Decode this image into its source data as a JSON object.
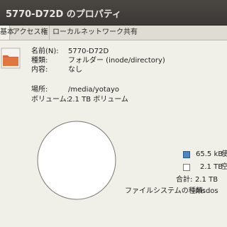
{
  "window": {
    "title": "5770-D72D のプロパティ"
  },
  "tabs": [
    {
      "label": "基本"
    },
    {
      "label": "アクセス権"
    },
    {
      "label": "ローカルネットワーク共有"
    }
  ],
  "basic": {
    "name_label": "名前(N):",
    "name_value": "5770-D72D",
    "type_label": "種類:",
    "type_value": "フォルダー (inode/directory)",
    "contents_label": "内容:",
    "contents_value": "なし",
    "location_label": "場所:",
    "location_value": "/media/yotayo",
    "volume_label": "ボリューム:",
    "volume_value": "2.1 TB ボリューム"
  },
  "usage": {
    "used_value": "65.5 kB",
    "used_label": "使",
    "free_value": "2.1 TB",
    "free_label": "空",
    "total_label": "合計:",
    "total_value": "2.1 TB",
    "filesystem_label": "ファイルシステムの種類:",
    "filesystem_value": "msdos",
    "used_color": "#4a86c5",
    "free_color": "#ffffff"
  },
  "icons": {
    "folder": "folder-icon"
  }
}
